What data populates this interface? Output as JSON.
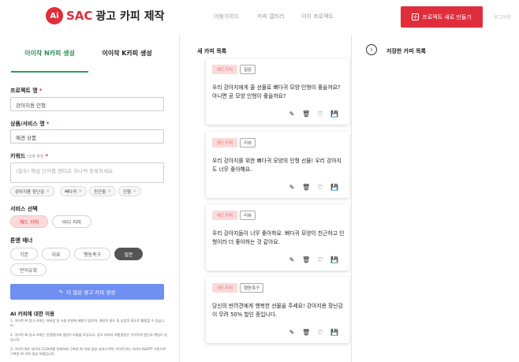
{
  "header": {
    "logo_ai": "Ai",
    "logo_sac": "SAC",
    "logo_text": "광고 카피 제작",
    "nav": [
      "이용가이드",
      "카피 갤러리",
      "이이 프로젝트"
    ],
    "new_project": "프로젝트 새로 만들기",
    "logout": "로그아웃"
  },
  "left": {
    "tab_n": "이이작 N카피 생성",
    "tab_k": "이이작 K카피 생성",
    "project_label": "프로젝트 명",
    "project_value": "강아지용 인형",
    "product_label": "상품/서비스 명",
    "product_value": "애견 상품",
    "keyword_label": "키워드",
    "keyword_hint": "*2개 추천",
    "keyword_placeholder": "(필수) 핵심 단어를 엔터로 하나씩 등록하세요",
    "chips": [
      "강아지용 장난감",
      "뻐다귀",
      "친근함",
      "인형"
    ],
    "service_label": "서비스 선택",
    "services": [
      "헤드 카피",
      "바디 카피"
    ],
    "tone_label": "톤앤 매너",
    "tones": [
      "기본",
      "리뷰",
      "행동촉구",
      "질문",
      "언어유희"
    ],
    "generate": "더 많은 광고 카피 생성",
    "info_title": "AI 카피에 대한 이용",
    "info": [
      "1. 이이작 AI 광고 카피는 허위성 및 사용 손한에 제한이 없으며, 개인의 용도 및 상업적 용도로 활용할 수 있습니다.",
      "2. 이이작 AI 광고 카피는 인정형이에 생성이 모듈을 토입니다. 광고 카피의 최종결정은 이이작의 판단과 책임이 있습니다.",
      "3. 이이작 N은 네이버 CLOVA를 연계하여 구축한 AI 카피 생성 서비스이며, 이이작 K는 카카오 KoGPT 기반으로 구축한 AI 카피 생성 모델입니다."
    ]
  },
  "middle": {
    "title": "새 카피 목록",
    "cards": [
      {
        "tag1": "헤드카피",
        "tag2": "질문",
        "text": "우리 강아지에게 줄 선물로 뻐다귀 모양 인형이 좋을까요? 아니면 공 모양 인형이 좋을까요?"
      },
      {
        "tag1": "헤드카피",
        "tag2": "리뷰",
        "text": "우리 강아지를 위한 뻐다귀 모양의 인형 선물! 우리 강아지도 너무 좋아해요."
      },
      {
        "tag1": "헤드카피",
        "tag2": "리뷰",
        "text": "우리 강아지들이 너무 좋아하요. 뻐다귀 모양이 친근하고 인형이라 더 좋아하는 것 같아요."
      },
      {
        "tag1": "헤드카피",
        "tag2": "행동촉구",
        "text": "당신의 반려견에게 행복한 선물을 주세요! 강아지용 장난감이 무려 50% 할인 중입니다."
      }
    ]
  },
  "right": {
    "title": "저장한 카피 목록",
    "chevron": "›"
  },
  "icons": {
    "edit": "✎",
    "delete": "🗑",
    "like": "♡",
    "save": "💾"
  }
}
